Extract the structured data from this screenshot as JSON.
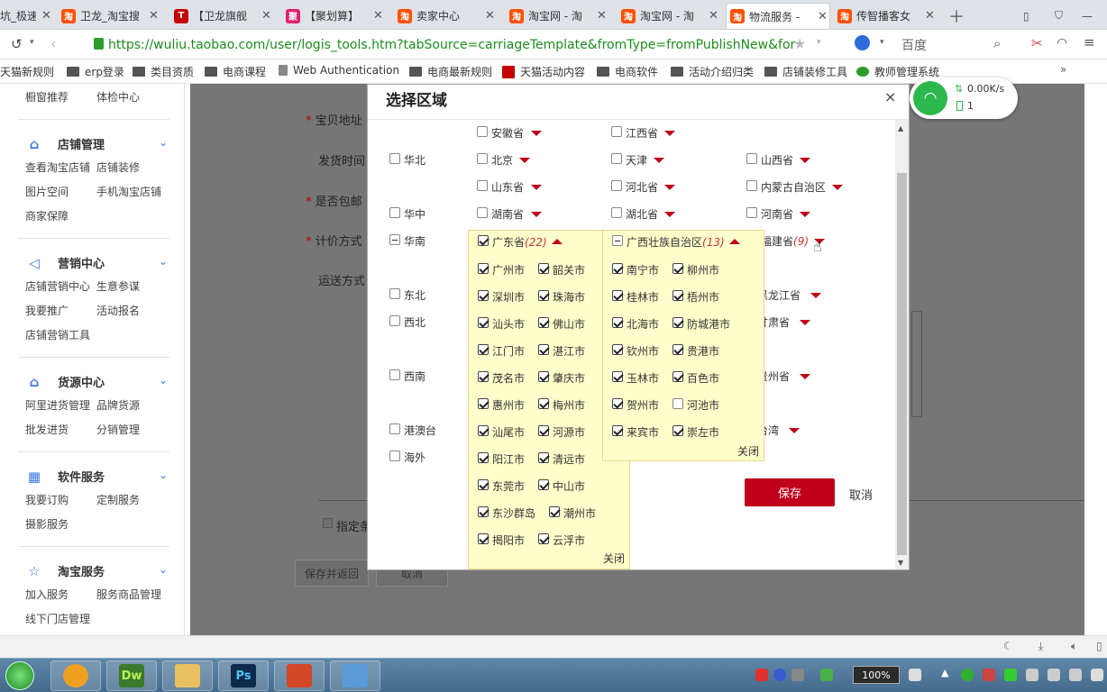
{
  "tabs": [
    {
      "label": "坑_极速",
      "fav": "",
      "color": "#dfe3e8"
    },
    {
      "label": "卫龙_淘宝搜",
      "fav": "淘",
      "color": "#ff5000"
    },
    {
      "label": "【卫龙旗舰",
      "fav": "T",
      "color": "#c40000"
    },
    {
      "label": "【聚划算】",
      "fav": "聚",
      "color": "#e0206c"
    },
    {
      "label": "卖家中心",
      "fav": "淘",
      "color": "#ff5000"
    },
    {
      "label": "淘宝网 - 淘",
      "fav": "淘",
      "color": "#ff5000"
    },
    {
      "label": "淘宝网 - 淘",
      "fav": "淘",
      "color": "#ff5000"
    },
    {
      "label": "物流服务 -",
      "fav": "淘",
      "color": "#ff5000"
    },
    {
      "label": "传智播客女",
      "fav": "淘",
      "color": "#ff5000"
    }
  ],
  "url": "https://wuliu.taobao.com/user/logis_tools.htm?tabSource=carriageTemplate&fromType=fromPublishNew&for",
  "search_engine": "百度",
  "bookmarks": [
    "天猫新规则",
    "erp登录",
    "类目资质",
    "电商课程",
    "Web Authentication",
    "电商最新规则",
    "天猫活动内容",
    "电商软件",
    "活动介绍归类",
    "店铺装修工具",
    "教师管理系统"
  ],
  "sidebar": {
    "top_links": [
      "橱窗推荐",
      "体检中心"
    ],
    "sections": [
      {
        "title": "店铺管理",
        "links": [
          "查看淘宝店铺",
          "店铺装修",
          "图片空间",
          "手机淘宝店铺",
          "商家保障"
        ]
      },
      {
        "title": "营销中心",
        "links": [
          "店铺营销中心",
          "生意参谋",
          "我要推广",
          "活动报名",
          "店铺营销工具"
        ]
      },
      {
        "title": "货源中心",
        "links": [
          "阿里进货管理",
          "品牌货源",
          "批发进货",
          "分销管理"
        ]
      },
      {
        "title": "软件服务",
        "links": [
          "我要订购",
          "定制服务",
          "摄影服务"
        ]
      },
      {
        "title": "淘宝服务",
        "links": [
          "加入服务",
          "服务商品管理",
          "线下门店管理"
        ]
      }
    ]
  },
  "form": {
    "address_label": "宝贝地址",
    "ship_time_label": "发货时间",
    "free_ship_label": "是否包邮",
    "pricing_label": "计价方式",
    "delivery_label": "运送方式",
    "designate_label": "指定条",
    "save_back": "保存并返回",
    "cancel": "取消"
  },
  "modal": {
    "title": "选择区域",
    "close": "×",
    "save": "保存",
    "cancel": "取消",
    "regions": {
      "huadong_partial": [
        "安徽省",
        "江西省"
      ],
      "huabei": "华北",
      "huabei_provs": [
        "北京",
        "天津",
        "山西省",
        "山东省",
        "河北省",
        "内蒙古自治区"
      ],
      "huazhong": "华中",
      "huazhong_provs": [
        "湖南省",
        "湖北省",
        "河南省"
      ],
      "huanan": "华南",
      "guangdong": "广东省",
      "guangdong_count": "(22)",
      "guangxi": "广西壮族自治区",
      "guangxi_count": "(13)",
      "fujian": "福建省",
      "fujian_count": "(9)",
      "dongbei": "东北",
      "heilongjiang": "黑龙江省",
      "xibei": "西北",
      "gansu": "甘肃省",
      "xinan": "西南",
      "guizhou": "贵州省",
      "gangaotai": "港澳台",
      "taiwan": "台湾",
      "haiwai": "海外"
    },
    "guangdong_cities": [
      "广州市",
      "韶关市",
      "深圳市",
      "珠海市",
      "汕头市",
      "佛山市",
      "江门市",
      "湛江市",
      "茂名市",
      "肇庆市",
      "惠州市",
      "梅州市",
      "汕尾市",
      "河源市",
      "阳江市",
      "清远市",
      "东莞市",
      "中山市",
      "东沙群岛",
      "潮州市",
      "揭阳市",
      "云浮市"
    ],
    "guangxi_cities": [
      "南宁市",
      "柳州市",
      "桂林市",
      "梧州市",
      "北海市",
      "防城港市",
      "钦州市",
      "贵港市",
      "玉林市",
      "百色市",
      "贺州市",
      "河池市",
      "来宾市",
      "崇左市"
    ],
    "guangxi_checked": [
      true,
      true,
      true,
      true,
      true,
      true,
      true,
      true,
      true,
      true,
      true,
      false,
      true,
      true
    ],
    "popup_close": "关闭"
  },
  "net": {
    "speed": "0.00K/s",
    "count": "1"
  },
  "taskbar": {
    "zoom": "100%"
  }
}
